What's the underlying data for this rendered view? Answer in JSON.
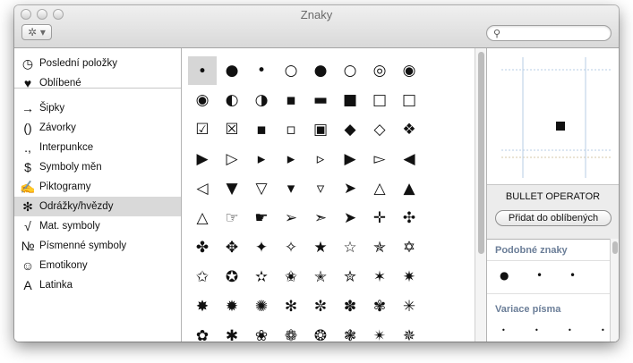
{
  "window": {
    "title": "Znaky"
  },
  "toolbar": {
    "action_glyph": "✲ ▾",
    "search_placeholder": ""
  },
  "sidebar": {
    "items": [
      {
        "icon": "◷",
        "icon_name": "clock-icon",
        "label": "Poslední položky"
      },
      {
        "icon": "♥",
        "icon_name": "heart-icon",
        "label": "Oblíbené"
      },
      {
        "icon": "→",
        "icon_name": "arrow-icon",
        "label": "Šipky"
      },
      {
        "icon": "()",
        "icon_name": "parentheses-icon",
        "label": "Závorky"
      },
      {
        "icon": ".,",
        "icon_name": "punctuation-icon",
        "label": "Interpunkce"
      },
      {
        "icon": "$",
        "icon_name": "dollar-icon",
        "label": "Symboly měn"
      },
      {
        "icon": "✍",
        "icon_name": "writing-hand-icon",
        "label": "Piktogramy"
      },
      {
        "icon": "✻",
        "icon_name": "asterisk-icon",
        "label": "Odrážky/hvězdy"
      },
      {
        "icon": "√",
        "icon_name": "square-root-icon",
        "label": "Mat. symboly"
      },
      {
        "icon": "№",
        "icon_name": "numero-icon",
        "label": "Písmenné symboly"
      },
      {
        "icon": "☺",
        "icon_name": "smiley-icon",
        "label": "Emotikony"
      },
      {
        "icon": "A",
        "icon_name": "letter-a-icon",
        "label": "Latinka"
      }
    ],
    "selected_index": 7
  },
  "grid": {
    "rows": [
      [
        "∙",
        "●",
        "•",
        "○",
        "●",
        "○",
        "◎",
        "◉"
      ],
      [
        "◉",
        "◐",
        "◑",
        "▪",
        "▬",
        "■",
        "□",
        "□"
      ],
      [
        "☑",
        "☒",
        "▪",
        "▫",
        "▣",
        "◆",
        "◇",
        "❖"
      ],
      [
        "▶",
        "▷",
        "▸",
        "▸",
        "▹",
        "▶",
        "▻",
        "◀"
      ],
      [
        "◁",
        "▼",
        "▽",
        "▾",
        "▿",
        "➤",
        "△",
        "▲"
      ],
      [
        "△",
        "☞",
        "☛",
        "➢",
        "➣",
        "➤",
        "✛",
        "✣"
      ],
      [
        "✤",
        "✥",
        "✦",
        "✧",
        "★",
        "☆",
        "✯",
        "✡"
      ],
      [
        "✩",
        "✪",
        "✫",
        "✬",
        "✭",
        "✮",
        "✶",
        "✷"
      ],
      [
        "✸",
        "✹",
        "✺",
        "✻",
        "✼",
        "✽",
        "✾",
        "✳"
      ],
      [
        "✿",
        "✱",
        "❀",
        "❁",
        "❂",
        "❃",
        "✴",
        "✵"
      ]
    ],
    "selected": [
      0,
      0
    ]
  },
  "detail": {
    "preview_char": "■",
    "char_name": "BULLET OPERATOR",
    "fav_button": "Přidat do oblíbených",
    "similar_title": "Podobné znaky",
    "similar_chars": [
      "●",
      "•",
      "•"
    ],
    "variants_title": "Variace písma",
    "variant_chars": [
      "•",
      "•",
      "•",
      "•"
    ]
  }
}
